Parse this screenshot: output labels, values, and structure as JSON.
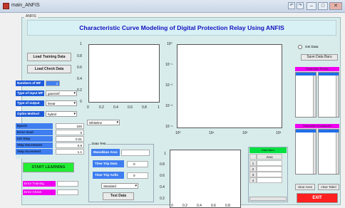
{
  "window": {
    "title": "main_ANFIS",
    "min": "–",
    "max": "□",
    "close": "✕"
  },
  "toolbar": {
    "icons": [
      "↶",
      "↷",
      "↻"
    ]
  },
  "panel": {
    "label": "ANFIS"
  },
  "header": {
    "title": "Characteristic Curve Modeling of Digital Protection Relay Using ANFIS"
  },
  "buttons": {
    "load_training": "Load Training Data",
    "load_check": "Load Check Data",
    "start_learning": "START LEARNING",
    "test_data": "Test Data",
    "get_data": "Get Data",
    "save_data_baru": "Save Data Baru",
    "clear_axes": "clear Axes",
    "clear_tabel": "clear Tabel",
    "exit": "EXIT"
  },
  "params": {
    "numbers_mf_label": "Numbers of MF",
    "numbers_mf_value": "3",
    "type_input_mf_label": "Type of input MF",
    "type_input_mf_value": "gaussmf",
    "type_output_mf_label": "Type of output MF",
    "type_output_mf_value": "linear",
    "optim_label": "Optim Method",
    "optim_value": "hybrid"
  },
  "training": [
    {
      "label": "Epoch",
      "value": "100"
    },
    {
      "label": "Error Goal",
      "value": "0"
    },
    {
      "label": "Init Step",
      "value": "0.01"
    },
    {
      "label": "Step Decrement",
      "value": "0.9"
    },
    {
      "label": "Step Increment",
      "value": "1.1"
    }
  ],
  "errors": {
    "training_label": "Error Training",
    "training_value": "",
    "checking_label": "Error Check",
    "checking_value": ""
  },
  "plot1": {
    "yticks": [
      "1",
      "0.8",
      "0.6",
      "0.4",
      "0.2",
      "0"
    ],
    "xticks": [
      "0",
      "0.2",
      "0.4",
      "0.6",
      "0.8",
      "1"
    ]
  },
  "plot2": {
    "yticks": [
      "10⁰",
      "10⁻¹",
      "10⁻²",
      "10⁻³",
      "10⁻⁴"
    ],
    "xticks": [
      "10⁰",
      "10¹",
      "10²",
      "10³"
    ]
  },
  "plot3": {
    "yticks": [
      "1",
      "0.8",
      "0.6",
      "0.4",
      "0.2"
    ],
    "xticks": [
      "0",
      "0.2",
      "0.4",
      "0.6",
      "0.8"
    ]
  },
  "curve_select": {
    "value": "Whiteline"
  },
  "datatest": {
    "label": "Data Test",
    "masukkan_label": "Masukkan Arus",
    "masukkan_value": "",
    "time_trip_data_label": "Time Trip Data",
    "time_trip_data_value": "0",
    "time_trip_anfis_label": "Time Trip Anfis",
    "time_trip_anfis_value": "0",
    "standard_value": "Standard"
  },
  "databaru": {
    "title": "Data Baru",
    "col_header": "Arus",
    "rows": [
      "1",
      "2",
      "3",
      "4"
    ]
  },
  "right": {
    "parameter_premis": "Parameter Premis",
    "parameter_konsekuen": "Parameter Konsekuen",
    "mini_left": "1",
    "mini_right": "1"
  }
}
